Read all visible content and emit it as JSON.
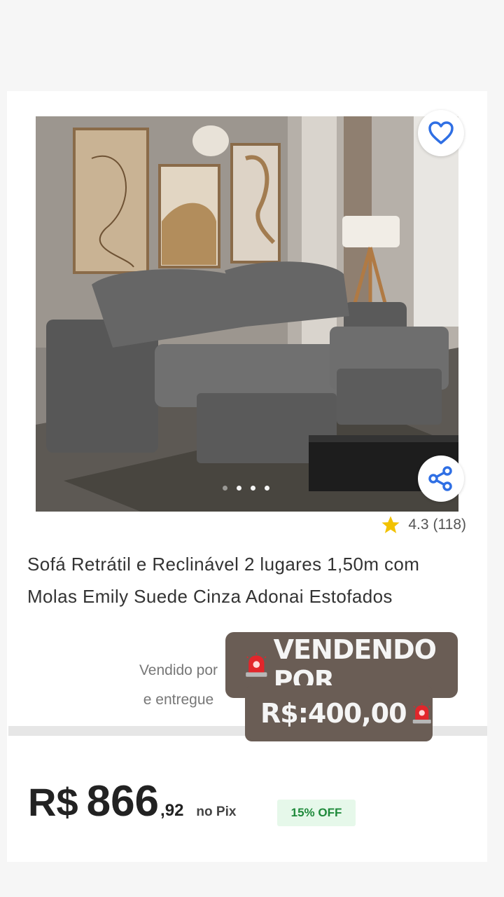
{
  "product": {
    "title": "Sofá Retrátil e Reclinável 2 lugares 1,50m com Molas Emily Suede Cinza Adonai Estofados",
    "rating": "4.3",
    "reviews": "(118)",
    "seller_line1": "Vendido por",
    "seller_line2": "e entregue",
    "gallery_dots": 4,
    "gallery_active_index": 2
  },
  "price": {
    "currency": "R$",
    "integer": "866",
    "cents": ",92",
    "method": "no Pix",
    "discount": "15% OFF"
  },
  "overlay": {
    "line1": "VENDENDO POR",
    "line2": "R$:400,00"
  },
  "icons": {
    "favorite": "heart-icon",
    "share": "share-icon",
    "star": "star-icon",
    "siren": "siren-icon"
  },
  "colors": {
    "accent_blue": "#2f6fe4",
    "star": "#f2c200",
    "discount_text": "#1f8a3b",
    "discount_bg": "#e6f8ea",
    "sticker_bg": "#6a5d55"
  }
}
